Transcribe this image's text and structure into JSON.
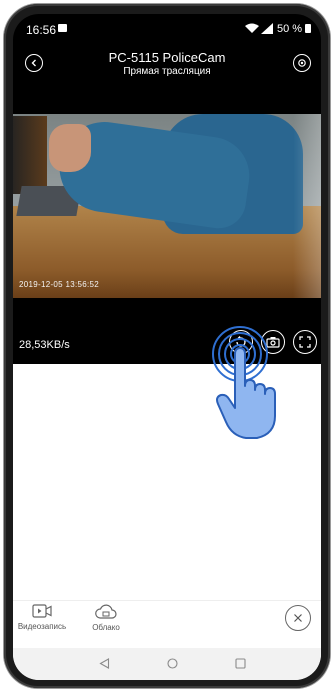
{
  "status_bar": {
    "time": "16:56",
    "battery": "50 %"
  },
  "header": {
    "title": "PC-5115 PoliceCam",
    "subtitle": "Прямая трасляция"
  },
  "video": {
    "timestamp": "2019-12-05  13:56:52"
  },
  "controls": {
    "bitrate": "28,53KB/s"
  },
  "toolbar": {
    "video_record_label": "Видеозапись",
    "cloud_label": "Облако"
  },
  "colors": {
    "dark_bg": "#000000",
    "accent_tap": "#2f6fd1"
  }
}
